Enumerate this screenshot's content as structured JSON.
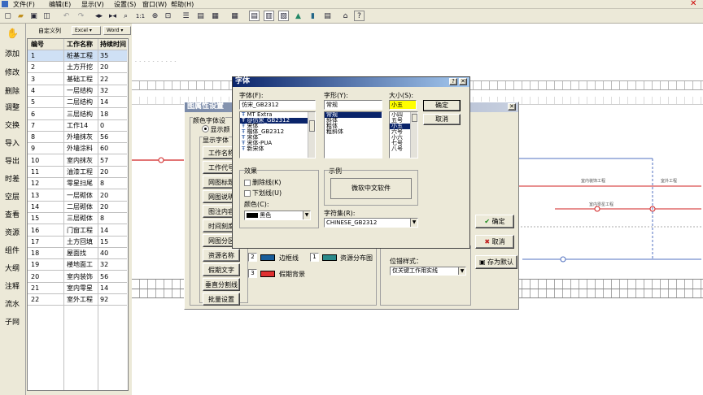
{
  "menu": [
    "文件(F)",
    "编辑(E)",
    "显示(V)",
    "设置(S)",
    "窗口(W)",
    "帮助(H)"
  ],
  "toolbar_zoom": "1:1",
  "sidebar": [
    "添加",
    "修改",
    "删除",
    "调整",
    "交换",
    "导入",
    "导出",
    "时差",
    "空层",
    "查看",
    "资源",
    "组件",
    "大纲",
    "注释",
    "流水",
    "子网"
  ],
  "subbar": {
    "custom_cols": "自定义列",
    "excel": "Excel",
    "word": "Word"
  },
  "grid": {
    "headers": [
      "编号",
      "工作名称",
      "持续时间"
    ],
    "rows": [
      [
        "1",
        "桩基工程",
        "35"
      ],
      [
        "2",
        "土方开挖",
        "20"
      ],
      [
        "3",
        "基础工程",
        "22"
      ],
      [
        "4",
        "一层结构",
        "32"
      ],
      [
        "5",
        "二层结构",
        "14"
      ],
      [
        "6",
        "三层结构",
        "18"
      ],
      [
        "7",
        "工作14",
        "0"
      ],
      [
        "8",
        "外墙抹灰",
        "56"
      ],
      [
        "9",
        "外墙涂料",
        "60"
      ],
      [
        "10",
        "室内抹灰",
        "57"
      ],
      [
        "11",
        "油漆工程",
        "20"
      ],
      [
        "12",
        "零星扫尾",
        "8"
      ],
      [
        "13",
        "一层砌体",
        "20"
      ],
      [
        "14",
        "二层砌体",
        "20"
      ],
      [
        "15",
        "三层砌体",
        "8"
      ],
      [
        "16",
        "门窗工程",
        "14"
      ],
      [
        "17",
        "土方回填",
        "15"
      ],
      [
        "18",
        "屋面找",
        "40"
      ],
      [
        "19",
        "楼地面工",
        "32"
      ],
      [
        "20",
        "室内装饰",
        "56"
      ],
      [
        "21",
        "室内零星",
        "14"
      ],
      [
        "22",
        "室外工程",
        "92"
      ]
    ]
  },
  "chart_labels": [
    "室内装饰工程",
    "室外工程",
    "室内零星工程"
  ],
  "prop_dialog": {
    "title": "图属性设置",
    "group_color": "颜色字体设",
    "radio_show": "显示颜",
    "group_show": "显示字体",
    "buttons": [
      "工作名称",
      "工作代号",
      "网图标题",
      "网图说明",
      "图注内容",
      "时间刻度",
      "网图分区",
      "资源名称",
      "假期文字",
      "垂直分割线",
      "批量设置"
    ],
    "num1": "2",
    "label_edge": "边框线",
    "num2": "1",
    "label_res": "资源分布图",
    "num3": "3",
    "label_holiday": "假期背景",
    "position_label": "位错样式：",
    "position_value": "仅关键工作用实线",
    "ok": "确定",
    "cancel": "取消",
    "save_default": "存为默认"
  },
  "font_dialog": {
    "title": "字体",
    "font_label": "字体(F):",
    "font_value": "仿宋_GB2312",
    "fonts": [
      "MT Extra",
      "@仿宋_GB2312",
      "宋体",
      "楷体_GB2312",
      "宋体",
      "宋体-PUA",
      "新宋体"
    ],
    "style_label": "字形(Y):",
    "style_value": "常规",
    "styles": [
      "常规",
      "斜体",
      "粗体",
      "粗斜体"
    ],
    "size_label": "大小(S):",
    "size_value": "小五",
    "sizes": [
      "小四",
      "五号",
      "小五",
      "六号",
      "小六",
      "七号",
      "八号"
    ],
    "ok": "确定",
    "cancel": "取消",
    "effects_label": "效果",
    "strike": "删除线(K)",
    "underline": "下划线(U)",
    "color_label": "颜色(C):",
    "color_value": "黑色",
    "sample_label": "示例",
    "sample_text": "微软中文软件",
    "charset_label": "字符集(R):",
    "charset_value": "CHINESE_GB2312",
    "colors": {
      "edge_swatch": "#1a5e9a",
      "res_swatch": "#2a8a8a",
      "holiday_swatch": "#e03030"
    }
  }
}
